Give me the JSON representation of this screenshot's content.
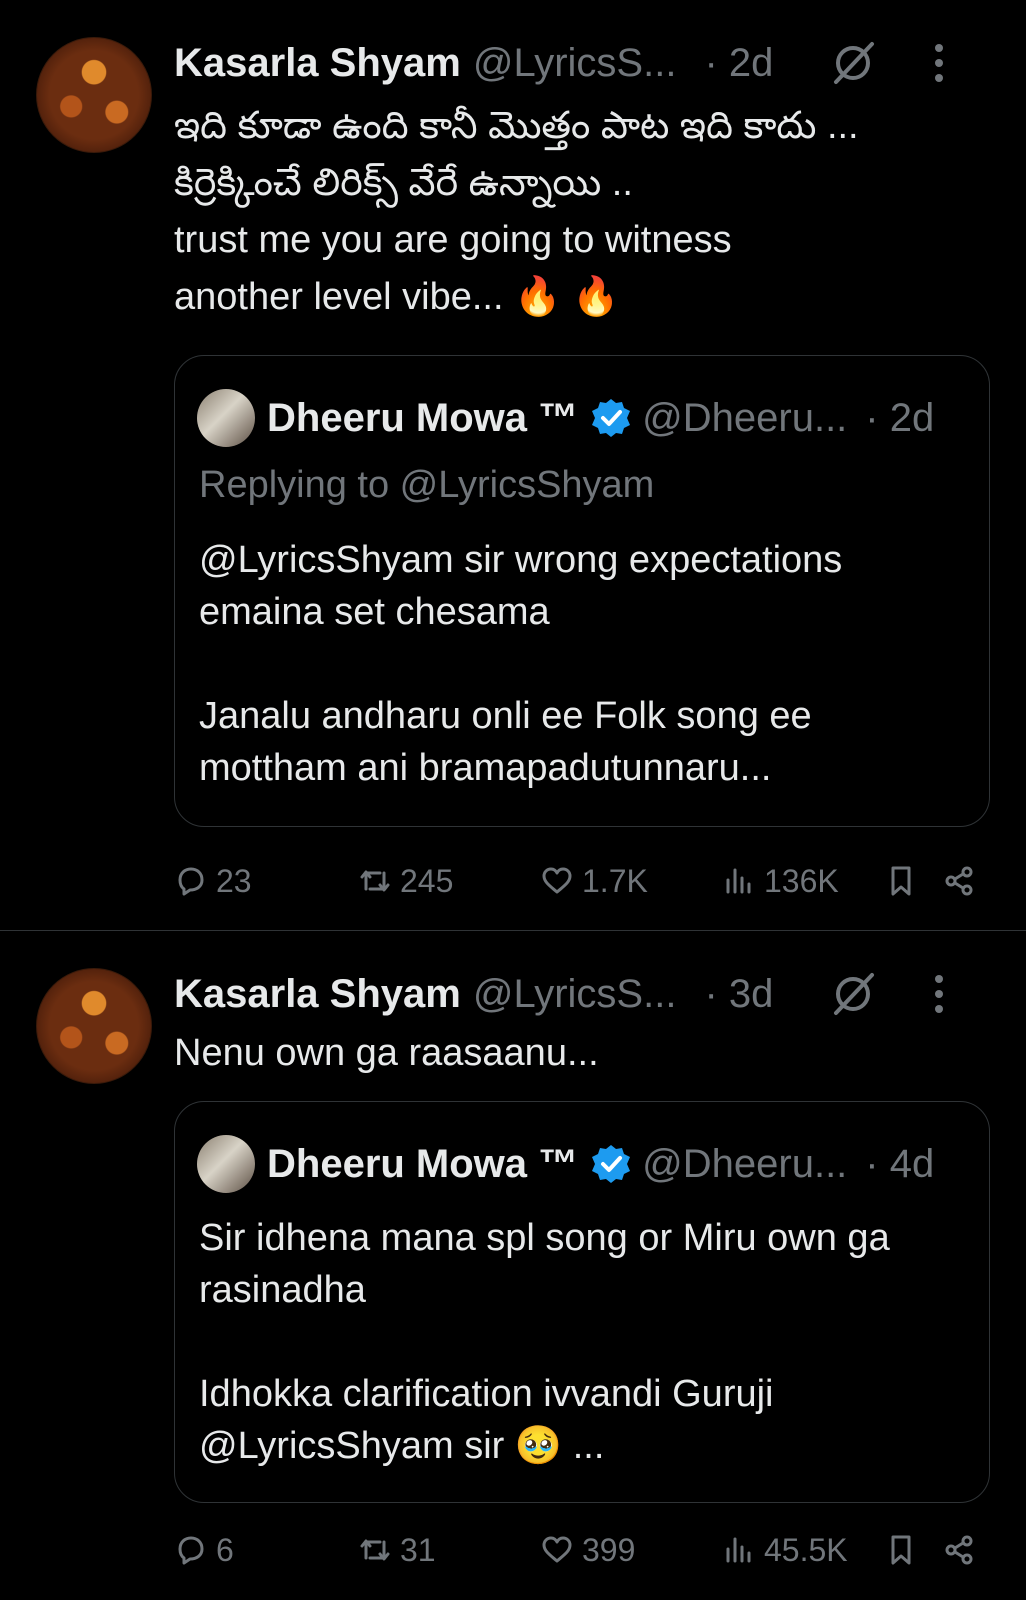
{
  "tweets": [
    {
      "author": "Kasarla Shyam",
      "handle": "@LyricsS...",
      "time": "· 2d",
      "lines": [
        "ఇది కూడా ఉంది కానీ మొత్తం పాట ఇది కాదు ...",
        "కిర్రెక్కించే లిరిక్స్ వేరే ఉన్నాయి ..",
        "trust me you are going to witness",
        "another level vibe... 🔥 🔥"
      ],
      "quote": {
        "author": "Dheeru Mowa ™",
        "handle": "@Dheeru...",
        "time": "· 2d",
        "replying_to": "Replying to @LyricsShyam",
        "paragraphs": [
          "@LyricsShyam sir wrong expectations emaina set chesama",
          "Janalu andharu onli ee Folk song ee mottham ani bramapadutunnaru..."
        ]
      },
      "stats": {
        "replies": "23",
        "retweets": "245",
        "likes": "1.7K",
        "views": "136K"
      }
    },
    {
      "author": "Kasarla Shyam",
      "handle": "@LyricsS...",
      "time": "· 3d",
      "lines": [
        "Nenu own ga raasaanu..."
      ],
      "quote": {
        "author": "Dheeru Mowa ™",
        "handle": "@Dheeru...",
        "time": "· 4d",
        "paragraphs": [
          "Sir idhena mana spl song or Miru own ga rasinadha",
          "Idhokka clarification ivvandi Guruji @LyricsShyam sir 🥹 ..."
        ]
      },
      "stats": {
        "replies": "6",
        "retweets": "31",
        "likes": "399",
        "views": "45.5K"
      }
    }
  ],
  "colors": {
    "background": "#000000",
    "text": "#e7e9ea",
    "muted": "#71767b",
    "verified": "#1d9bf0",
    "border": "#2f3336"
  },
  "icons": [
    "grok-icon",
    "more-icon",
    "reply-icon",
    "retweet-icon",
    "like-icon",
    "views-icon",
    "bookmark-icon",
    "share-icon",
    "verified-icon"
  ]
}
